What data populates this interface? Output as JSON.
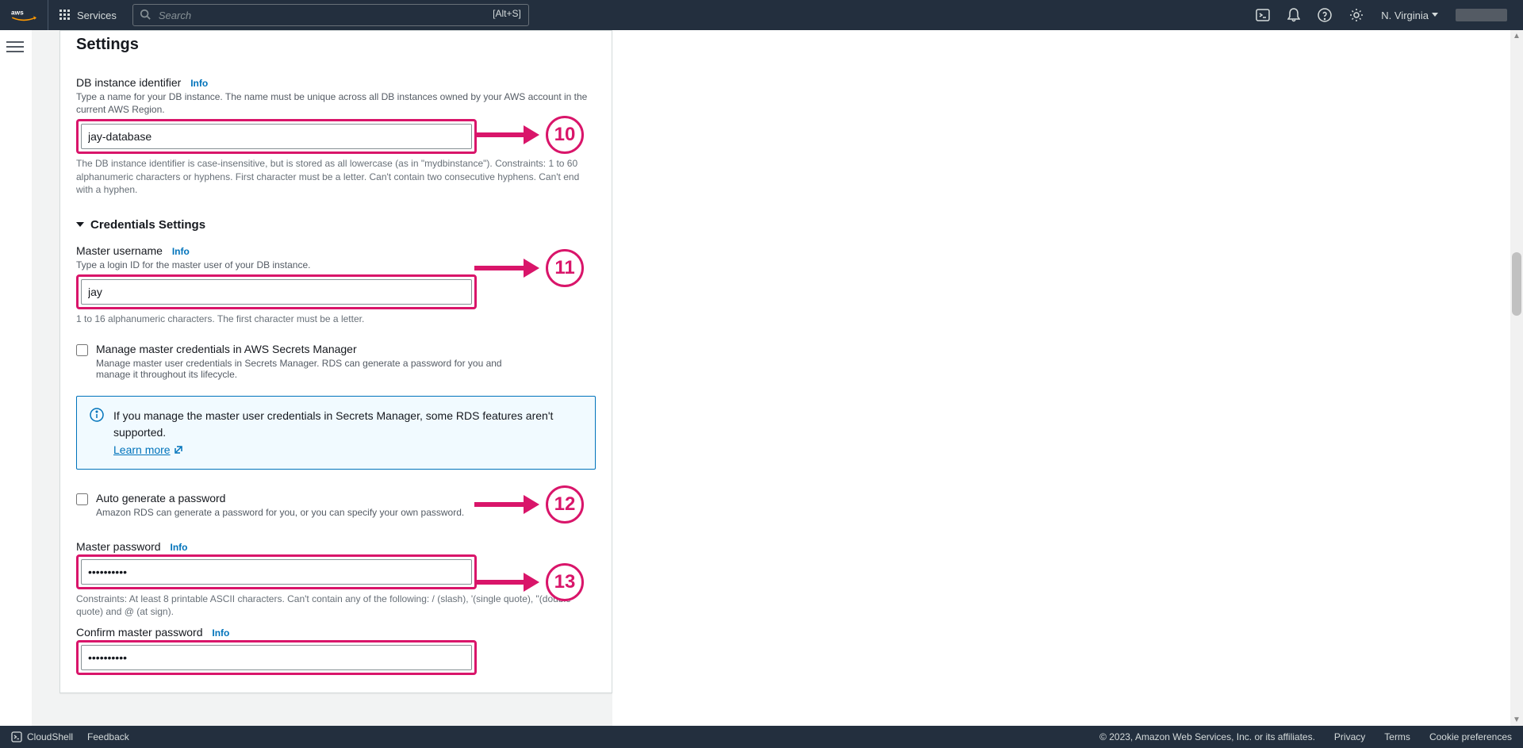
{
  "nav": {
    "services": "Services",
    "search_placeholder": "Search",
    "shortcut": "[Alt+S]",
    "region": "N. Virginia"
  },
  "page": {
    "title": "Settings",
    "db_id": {
      "label": "DB instance identifier",
      "info": "Info",
      "help": "Type a name for your DB instance. The name must be unique across all DB instances owned by your AWS account in the current AWS Region.",
      "value": "jay-database",
      "constraints": "The DB instance identifier is case-insensitive, but is stored as all lowercase (as in \"mydbinstance\"). Constraints: 1 to 60 alphanumeric characters or hyphens. First character must be a letter. Can't contain two consecutive hyphens. Can't end with a hyphen."
    },
    "cred_header": "Credentials Settings",
    "master_user": {
      "label": "Master username",
      "info": "Info",
      "help": "Type a login ID for the master user of your DB instance.",
      "value": "jay",
      "constraints": "1 to 16 alphanumeric characters. The first character must be a letter."
    },
    "secrets": {
      "label": "Manage master credentials in AWS Secrets Manager",
      "help": "Manage master user credentials in Secrets Manager. RDS can generate a password for you and manage it throughout its lifecycle."
    },
    "callout": {
      "msg": "If you manage the master user credentials in Secrets Manager, some RDS features aren't supported.",
      "link": "Learn more"
    },
    "autopw": {
      "label": "Auto generate a password",
      "help": "Amazon RDS can generate a password for you, or you can specify your own password."
    },
    "master_pw": {
      "label": "Master password",
      "info": "Info",
      "value": "••••••••••",
      "constraints": "Constraints: At least 8 printable ASCII characters. Can't contain any of the following: / (slash), '(single quote), \"(double quote) and @ (at sign)."
    },
    "confirm_pw": {
      "label": "Confirm master password",
      "info": "Info",
      "value": "••••••••••"
    }
  },
  "anno": {
    "n10": "10",
    "n11": "11",
    "n12": "12",
    "n13": "13"
  },
  "footer": {
    "cloudshell": "CloudShell",
    "feedback": "Feedback",
    "copy": "© 2023, Amazon Web Services, Inc. or its affiliates.",
    "privacy": "Privacy",
    "terms": "Terms",
    "cookies": "Cookie preferences"
  }
}
